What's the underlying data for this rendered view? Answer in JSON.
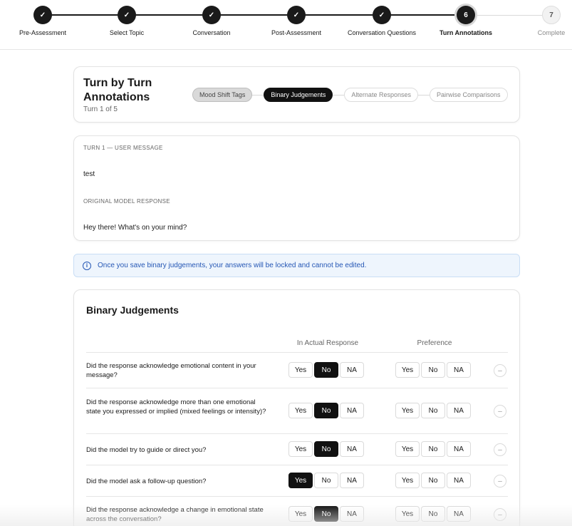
{
  "stepper": {
    "steps": [
      {
        "label": "Pre-Assessment",
        "status": "done",
        "number": ""
      },
      {
        "label": "Select Topic",
        "status": "done",
        "number": ""
      },
      {
        "label": "Conversation",
        "status": "done",
        "number": ""
      },
      {
        "label": "Post-Assessment",
        "status": "done",
        "number": ""
      },
      {
        "label": "Conversation Questions",
        "status": "done",
        "number": ""
      },
      {
        "label": "Turn Annotations",
        "status": "current",
        "number": "6"
      },
      {
        "label": "Complete",
        "status": "todo",
        "number": "7"
      }
    ],
    "check_glyph": "✓"
  },
  "header": {
    "title": "Turn by Turn Annotations",
    "subtitle": "Turn 1 of 5",
    "pills": [
      {
        "label": "Mood Shift Tags",
        "state": "done"
      },
      {
        "label": "Binary Judgements",
        "state": "active"
      },
      {
        "label": "Alternate Responses",
        "state": "todo"
      },
      {
        "label": "Pairwise Comparisons",
        "state": "todo"
      }
    ]
  },
  "message": {
    "user_label": "TURN 1 — USER MESSAGE",
    "user_text": "test",
    "model_label": "ORIGINAL MODEL RESPONSE",
    "model_text": "Hey there! What's on your mind?"
  },
  "notice": {
    "icon": "info-icon",
    "icon_glyph": "i",
    "text": "Once you save binary judgements, your answers will be locked and cannot be edited."
  },
  "judgements": {
    "title": "Binary Judgements",
    "col_actual": "In Actual Response",
    "col_preference": "Preference",
    "options": [
      "Yes",
      "No",
      "NA"
    ],
    "clear_glyph": "–",
    "rows": [
      {
        "question": "Did the response acknowledge emotional content in your message?",
        "actual": "No",
        "preference": ""
      },
      {
        "question": "Did the response acknowledge more than one emotional state you expressed or implied (mixed feelings or intensity)?",
        "actual": "No",
        "preference": ""
      },
      {
        "question": "Did the model try to guide or direct you?",
        "actual": "No",
        "preference": ""
      },
      {
        "question": "Did the model ask a follow-up question?",
        "actual": "Yes",
        "preference": ""
      },
      {
        "question": "Did the response acknowledge a change in emotional state across the conversation?",
        "actual": "No",
        "preference": ""
      }
    ]
  },
  "colors": {
    "accent_dark": "#111111",
    "info_blue": "#2557b5",
    "info_bg": "#eef5fd"
  }
}
